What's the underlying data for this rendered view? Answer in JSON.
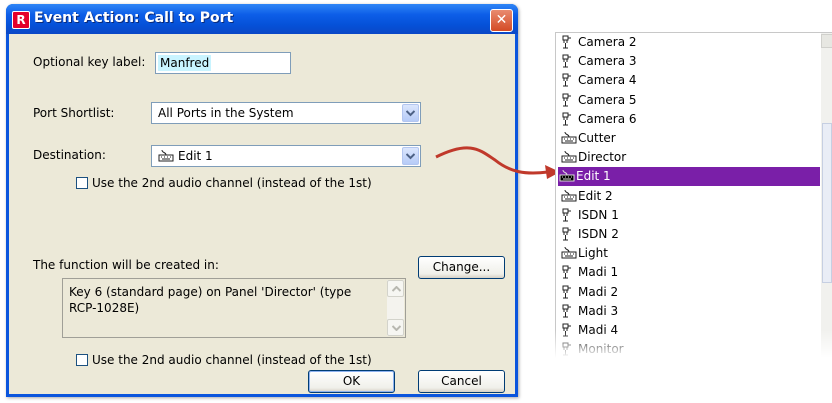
{
  "dialog": {
    "title": "Event Action: Call to Port",
    "key_label": "Optional key label:",
    "key_value": "Manfred",
    "shortlist_label": "Port Shortlist:",
    "shortlist_value": "All Ports in the System",
    "destination_label": "Destination:",
    "destination_value": "Edit 1",
    "audio_check_1": "Use the 2nd audio channel (instead of the 1st)",
    "function_label": "The function will be created in:",
    "function_text": "Key 6 (standard page) on Panel 'Director' (type RCP-1028E)",
    "change_button": "Change...",
    "audio_check_2": "Use the 2nd audio channel (instead of the 1st)",
    "ok_button": "OK",
    "cancel_button": "Cancel"
  },
  "list": {
    "items": [
      {
        "label": "Camera 2",
        "icon": "port-icon"
      },
      {
        "label": "Camera 3",
        "icon": "port-icon"
      },
      {
        "label": "Camera 4",
        "icon": "port-icon"
      },
      {
        "label": "Camera 5",
        "icon": "port-icon"
      },
      {
        "label": "Camera 6",
        "icon": "port-icon"
      },
      {
        "label": "Cutter",
        "icon": "keyboard-icon"
      },
      {
        "label": "Director",
        "icon": "keyboard-icon"
      },
      {
        "label": "Edit 1",
        "icon": "keyboard-icon",
        "selected": true
      },
      {
        "label": "Edit 2",
        "icon": "keyboard-icon"
      },
      {
        "label": "ISDN 1",
        "icon": "port-icon"
      },
      {
        "label": "ISDN 2",
        "icon": "port-icon"
      },
      {
        "label": "Light",
        "icon": "keyboard-icon"
      },
      {
        "label": "Madi 1",
        "icon": "port-icon"
      },
      {
        "label": "Madi 2",
        "icon": "port-icon"
      },
      {
        "label": "Madi 3",
        "icon": "port-icon"
      },
      {
        "label": "Madi 4",
        "icon": "port-icon"
      },
      {
        "label": "Monitor",
        "icon": "port-icon"
      }
    ]
  },
  "colors": {
    "titlebar": "#0a55dd",
    "selection": "#7a1fa8",
    "arrow": "#c0392b"
  }
}
